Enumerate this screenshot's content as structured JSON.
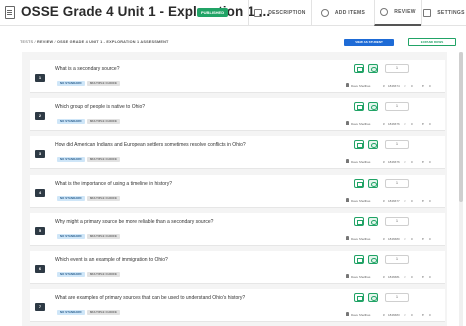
{
  "header": {
    "title": "OSSE Grade 4 Unit 1 - Exploration 1 ...",
    "status_badge": "PUBLISHED",
    "tabs": [
      {
        "label": "DESCRIPTION",
        "icon": "description-icon"
      },
      {
        "label": "ADD ITEMS",
        "icon": "add-items-icon"
      },
      {
        "label": "REVIEW",
        "icon": "review-icon"
      },
      {
        "label": "SETTINGS",
        "icon": "settings-icon"
      }
    ]
  },
  "breadcrumb": {
    "items": [
      "TESTS",
      "REVIEW",
      "OSSE GRADE 4 UNIT 1 - EXPLORATION 1 ASSESSMENT"
    ],
    "separator": "/"
  },
  "toolbar": {
    "view_as_student": "VIEW AS STUDENT",
    "expand_rows": "EXPAND ROWS"
  },
  "colors": {
    "accent_green": "#21a366",
    "primary_blue": "#1e6bd6",
    "number_badge": "#2e3a45"
  },
  "questions": [
    {
      "number": "1",
      "text": "What is a secondary source?",
      "standard": "NO STANDARD",
      "type": "MULTIPLE CHOICE",
      "points": "1",
      "author": "Dave Shellhas",
      "id": "1846674",
      "shares": "0",
      "likes": "0"
    },
    {
      "number": "2",
      "text": "Which group of people is native to Ohio?",
      "standard": "NO STANDARD",
      "type": "MULTIPLE CHOICE",
      "points": "1",
      "author": "Dave Shellhas",
      "id": "1846676",
      "shares": "0",
      "likes": "0"
    },
    {
      "number": "3",
      "text": "How did American Indians and European settlers sometimes resolve conflicts in Ohio?",
      "standard": "NO STANDARD",
      "type": "MULTIPLE CHOICE",
      "points": "1",
      "author": "Dave Shellhas",
      "id": "1846676",
      "shares": "0",
      "likes": "0"
    },
    {
      "number": "4",
      "text": "What is the importance of using a timeline in history?",
      "standard": "NO STANDARD",
      "type": "MULTIPLE CHOICE",
      "points": "1",
      "author": "Dave Shellhas",
      "id": "1846677",
      "shares": "0",
      "likes": "0"
    },
    {
      "number": "5",
      "text": "Why might a primary source be more reliable than a secondary source?",
      "standard": "NO STANDARD",
      "type": "MULTIPLE CHOICE",
      "points": "1",
      "author": "Dave Shellhas",
      "id": "1846680",
      "shares": "0",
      "likes": "0"
    },
    {
      "number": "6",
      "text": "Which event is an example of immigration to Ohio?",
      "standard": "NO STANDARD",
      "type": "MULTIPLE CHOICE",
      "points": "1",
      "author": "Dave Shellhas",
      "id": "1846681",
      "shares": "0",
      "likes": "0"
    },
    {
      "number": "7",
      "text": "What are examples of primary sources that can be used to understand Ohio's history?",
      "standard": "NO STANDARD",
      "type": "MULTIPLE CHOICE",
      "points": "1",
      "author": "Dave Shellhas",
      "id": "1846683",
      "shares": "0",
      "likes": "0"
    }
  ]
}
